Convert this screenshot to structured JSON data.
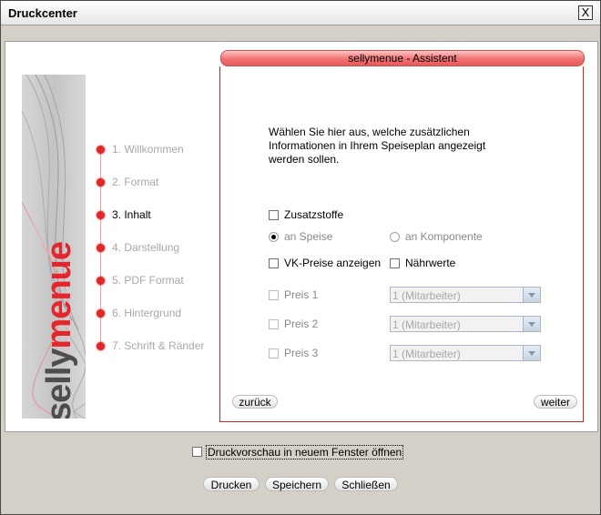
{
  "window": {
    "title": "Druckcenter",
    "close_label": "X"
  },
  "banner": {
    "brand_part1": "selly",
    "brand_part2": "menue"
  },
  "steps": [
    {
      "label": "1. Willkommen"
    },
    {
      "label": "2. Format"
    },
    {
      "label": "3. Inhalt",
      "active": true
    },
    {
      "label": "4. Darstellung"
    },
    {
      "label": "5. PDF Format"
    },
    {
      "label": "6. Hintergrund"
    },
    {
      "label": "7. Schrift & Ränder"
    }
  ],
  "wizard": {
    "header": "sellymenue - Assistent",
    "intro": "Wählen Sie hier aus, welche zusätzlichen Informationen in Ihrem Speiseplan angezeigt werden sollen.",
    "zusatzstoffe_label": "Zusatzstoffe",
    "an_speise_label": "an Speise",
    "an_komponente_label": "an Komponente",
    "vk_preise_label": "VK-Preise anzeigen",
    "naehrwerte_label": "Nährwerte",
    "preise": [
      {
        "label": "Preis 1",
        "select": "1 (Mitarbeiter)"
      },
      {
        "label": "Preis 2",
        "select": "1 (Mitarbeiter)"
      },
      {
        "label": "Preis 3",
        "select": "1 (Mitarbeiter)"
      }
    ],
    "back_label": "zurück",
    "next_label": "weiter"
  },
  "footer": {
    "preview_label": "Druckvorschau in neuem Fenster öffnen",
    "print_label": "Drucken",
    "save_label": "Speichern",
    "close_label": "Schließen"
  }
}
